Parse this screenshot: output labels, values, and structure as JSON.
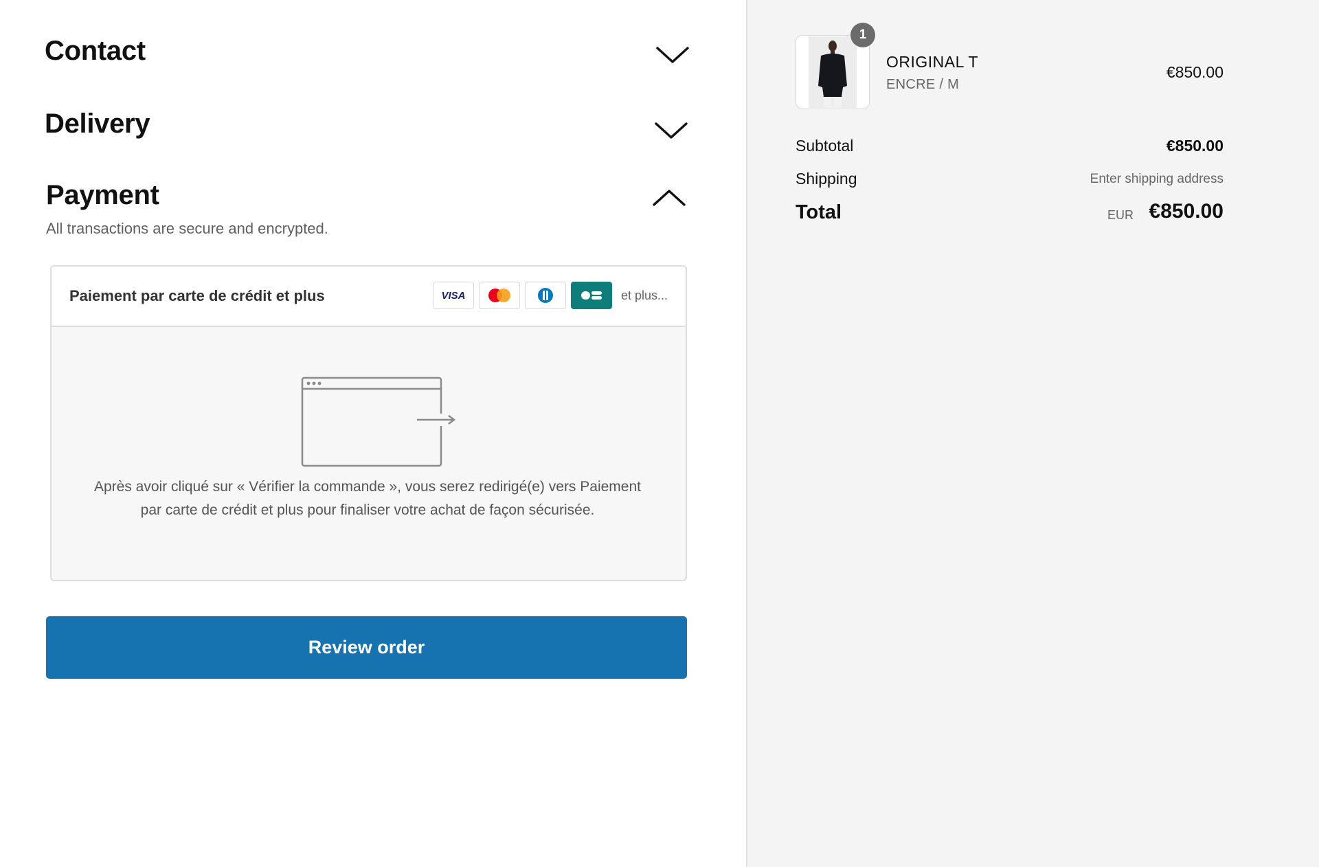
{
  "checkout": {
    "contact": {
      "title": "Contact",
      "chevron_icon": "chevron-down-icon"
    },
    "delivery": {
      "title": "Delivery",
      "chevron_icon": "chevron-down-icon"
    },
    "payment": {
      "title": "Payment",
      "chevron_icon": "chevron-up-icon",
      "subtitle": "All transactions are secure and encrypted.",
      "method_label": "Paiement par carte de crédit et plus",
      "card_brands": [
        "visa-icon",
        "mastercard-icon",
        "diners-icon",
        "cb-icon"
      ],
      "more_label": "et plus...",
      "redirect_icon": "browser-redirect-icon",
      "redirect_text": "Après avoir cliqué sur « Vérifier la commande », vous serez redirigé(e) vers Paiement par carte de crédit et plus pour finaliser votre achat de façon sécurisée."
    },
    "review_button": "Review order",
    "colors": {
      "primary": "#1773b0",
      "summary_bg": "#f4f4f4",
      "cb_brand": "#0f7d7a"
    }
  },
  "summary": {
    "item": {
      "quantity": "1",
      "name": "ORIGINAL T",
      "variant": "ENCRE / M",
      "price": "€850.00"
    },
    "subtotal": {
      "label": "Subtotal",
      "value": "€850.00"
    },
    "shipping": {
      "label": "Shipping",
      "value": "Enter shipping address"
    },
    "total": {
      "label": "Total",
      "currency": "EUR",
      "value": "€850.00"
    }
  }
}
